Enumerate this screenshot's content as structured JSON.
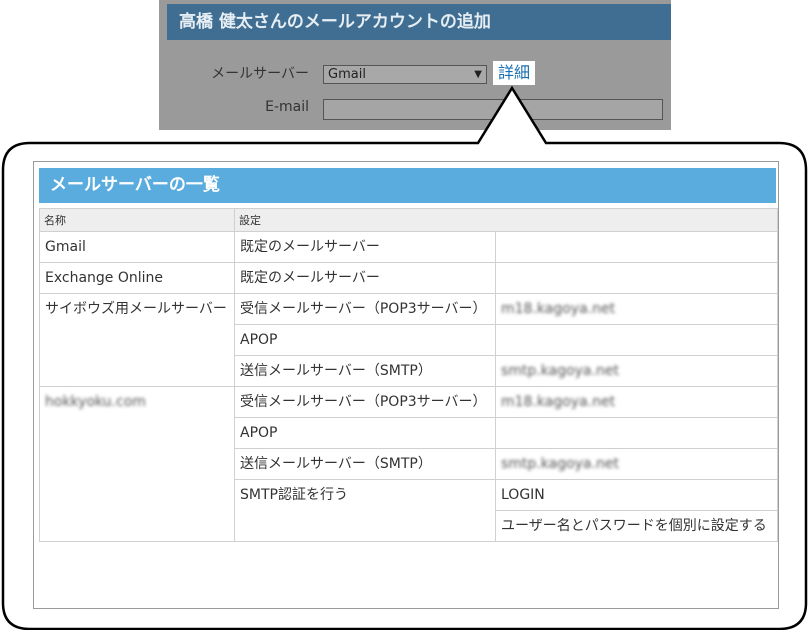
{
  "form": {
    "title": "高橋 健太さんのメールアカウントの追加",
    "mail_server_label": "メールサーバー",
    "mail_server_value": "Gmail",
    "detail_link": "詳細",
    "email_label": "E-mail"
  },
  "server_list": {
    "title": "メールサーバーの一覧",
    "headers": {
      "name": "名称",
      "settings": "設定"
    },
    "rows": {
      "gmail": {
        "name": "Gmail",
        "setting": "既定のメールサーバー"
      },
      "exchange": {
        "name": "Exchange Online",
        "setting": "既定のメールサーバー"
      },
      "cybozu": {
        "name": "サイボウズ用メールサーバー",
        "pop_label": "受信メールサーバー（POP3サーバー）",
        "pop_value": "m18.kagoya.net",
        "apop_label": "APOP",
        "smtp_label": "送信メールサーバー（SMTP）",
        "smtp_value": "smtp.kagoya.net"
      },
      "hokkyoku": {
        "name": "hokkyoku.com",
        "pop_label": "受信メールサーバー（POP3サーバー）",
        "pop_value": "m18.kagoya.net",
        "apop_label": "APOP",
        "smtp_label": "送信メールサーバー（SMTP）",
        "smtp_value": "smtp.kagoya.net",
        "auth_label": "SMTP認証を行う",
        "auth_value": "LOGIN",
        "auth_note": "ユーザー名とパスワードを個別に設定する"
      }
    }
  },
  "colors": {
    "form_title_bg": "#3f6e92",
    "list_title_bg": "#59acdd",
    "link": "#1a6fb2"
  }
}
